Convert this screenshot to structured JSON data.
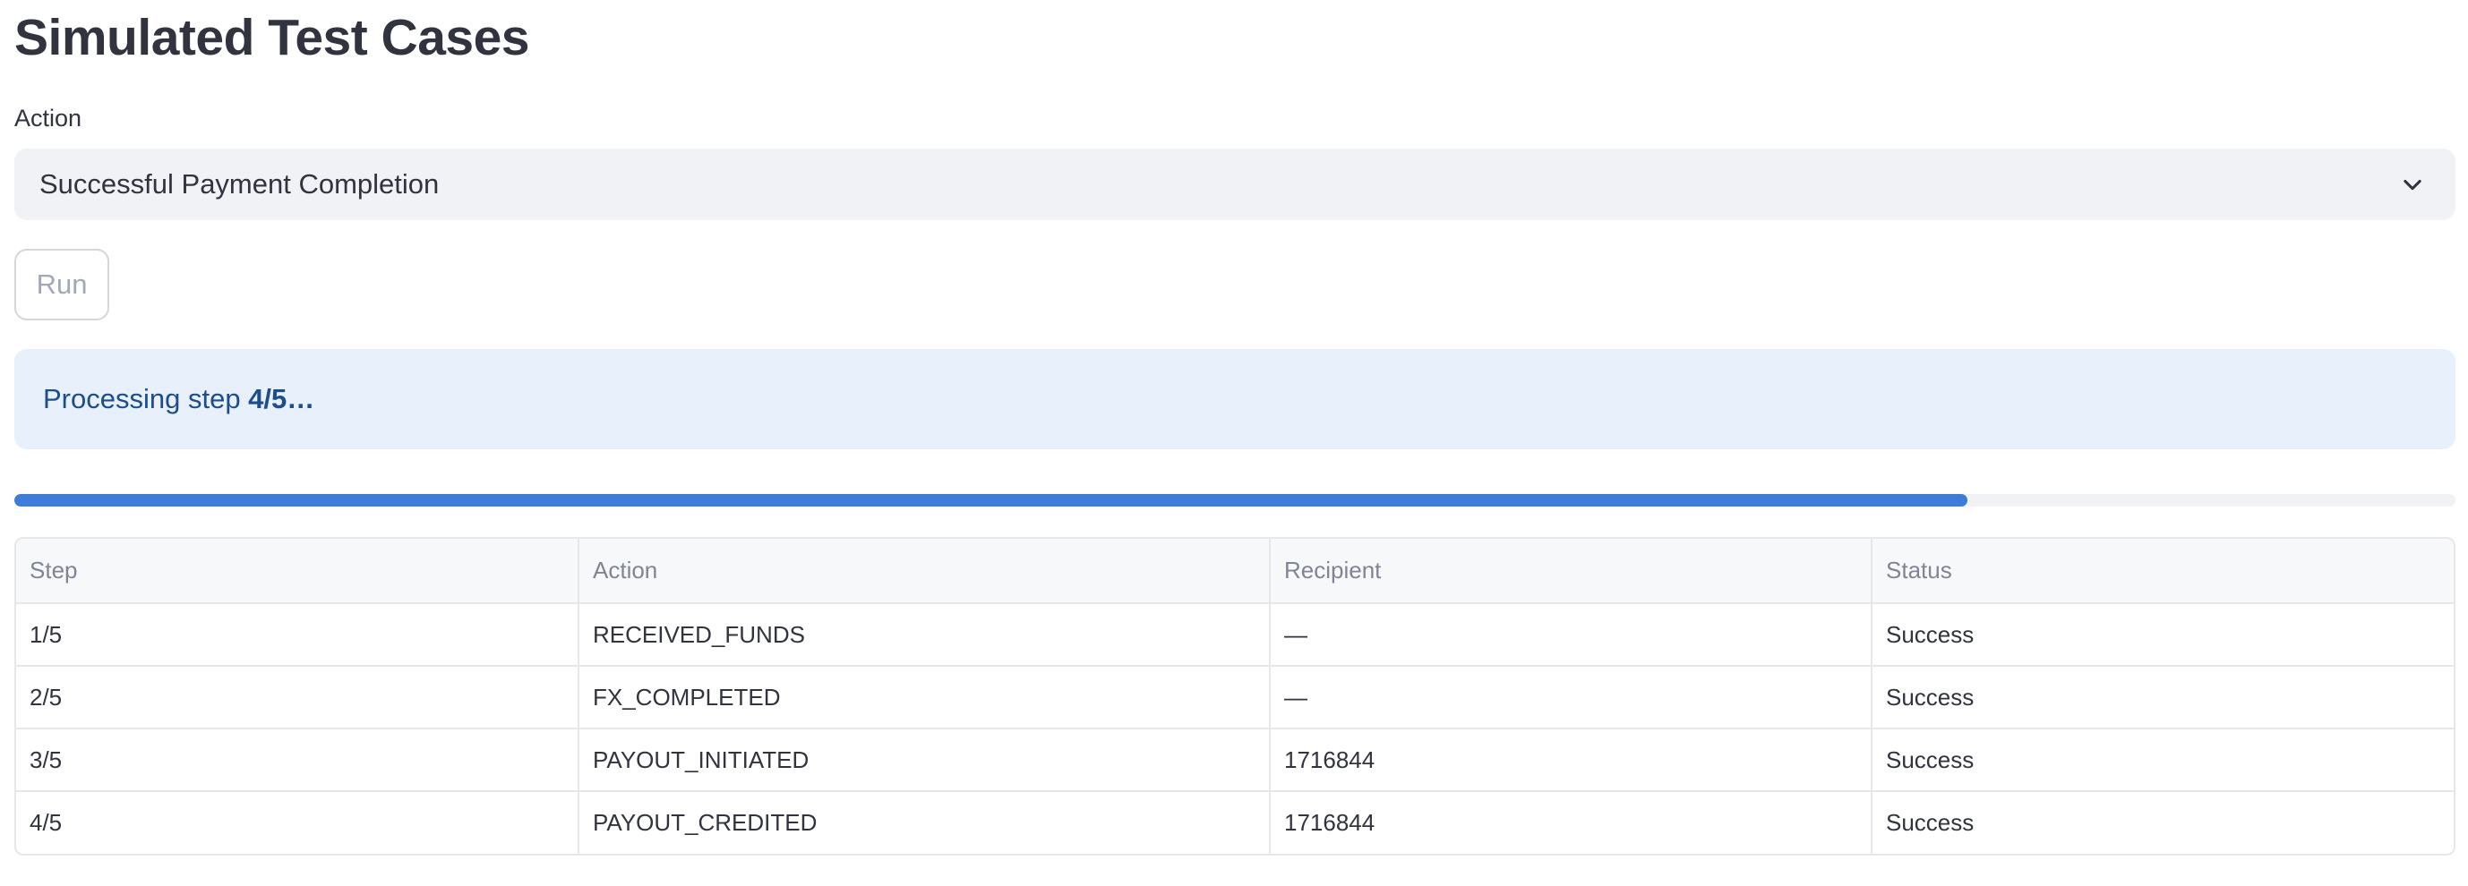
{
  "page": {
    "title": "Simulated Test Cases"
  },
  "action_select": {
    "label": "Action",
    "selected_value": "Successful Payment Completion",
    "icon": "chevron-down-icon"
  },
  "run_button": {
    "label": "Run",
    "state": "disabled"
  },
  "status_alert": {
    "prefix": "Processing step ",
    "step": "4/5",
    "suffix": "…",
    "color": "#1a4e8c",
    "background": "#e8f0fc"
  },
  "progress": {
    "value": 0.8,
    "fill_color": "#3b7dd8"
  },
  "results_table": {
    "columns": [
      "Step",
      "Action",
      "Recipient",
      "Status"
    ],
    "rows": [
      [
        "1/5",
        "RECEIVED_FUNDS",
        "—",
        "Success"
      ],
      [
        "2/5",
        "FX_COMPLETED",
        "—",
        "Success"
      ],
      [
        "3/5",
        "PAYOUT_INITIATED",
        "1716844",
        "Success"
      ],
      [
        "4/5",
        "PAYOUT_CREDITED",
        "1716844",
        "Success"
      ]
    ]
  }
}
